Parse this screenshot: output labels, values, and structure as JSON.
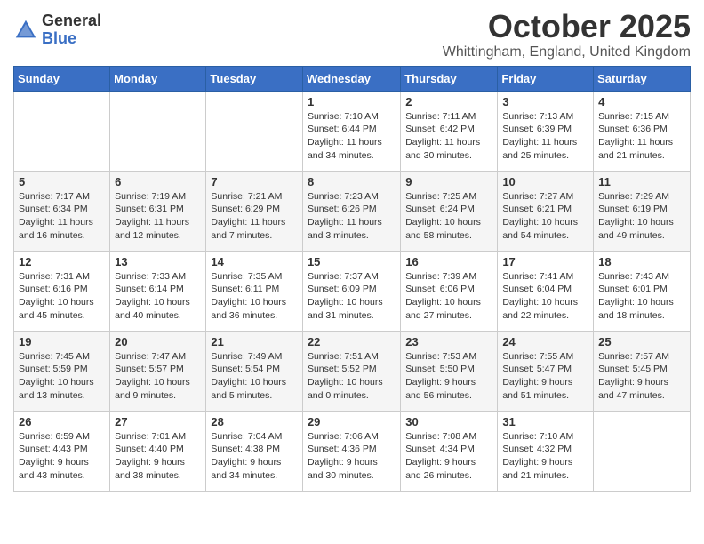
{
  "logo": {
    "general": "General",
    "blue": "Blue"
  },
  "title": "October 2025",
  "location": "Whittingham, England, United Kingdom",
  "days_of_week": [
    "Sunday",
    "Monday",
    "Tuesday",
    "Wednesday",
    "Thursday",
    "Friday",
    "Saturday"
  ],
  "weeks": [
    [
      {
        "day": "",
        "info": ""
      },
      {
        "day": "",
        "info": ""
      },
      {
        "day": "",
        "info": ""
      },
      {
        "day": "1",
        "info": "Sunrise: 7:10 AM\nSunset: 6:44 PM\nDaylight: 11 hours\nand 34 minutes."
      },
      {
        "day": "2",
        "info": "Sunrise: 7:11 AM\nSunset: 6:42 PM\nDaylight: 11 hours\nand 30 minutes."
      },
      {
        "day": "3",
        "info": "Sunrise: 7:13 AM\nSunset: 6:39 PM\nDaylight: 11 hours\nand 25 minutes."
      },
      {
        "day": "4",
        "info": "Sunrise: 7:15 AM\nSunset: 6:36 PM\nDaylight: 11 hours\nand 21 minutes."
      }
    ],
    [
      {
        "day": "5",
        "info": "Sunrise: 7:17 AM\nSunset: 6:34 PM\nDaylight: 11 hours\nand 16 minutes."
      },
      {
        "day": "6",
        "info": "Sunrise: 7:19 AM\nSunset: 6:31 PM\nDaylight: 11 hours\nand 12 minutes."
      },
      {
        "day": "7",
        "info": "Sunrise: 7:21 AM\nSunset: 6:29 PM\nDaylight: 11 hours\nand 7 minutes."
      },
      {
        "day": "8",
        "info": "Sunrise: 7:23 AM\nSunset: 6:26 PM\nDaylight: 11 hours\nand 3 minutes."
      },
      {
        "day": "9",
        "info": "Sunrise: 7:25 AM\nSunset: 6:24 PM\nDaylight: 10 hours\nand 58 minutes."
      },
      {
        "day": "10",
        "info": "Sunrise: 7:27 AM\nSunset: 6:21 PM\nDaylight: 10 hours\nand 54 minutes."
      },
      {
        "day": "11",
        "info": "Sunrise: 7:29 AM\nSunset: 6:19 PM\nDaylight: 10 hours\nand 49 minutes."
      }
    ],
    [
      {
        "day": "12",
        "info": "Sunrise: 7:31 AM\nSunset: 6:16 PM\nDaylight: 10 hours\nand 45 minutes."
      },
      {
        "day": "13",
        "info": "Sunrise: 7:33 AM\nSunset: 6:14 PM\nDaylight: 10 hours\nand 40 minutes."
      },
      {
        "day": "14",
        "info": "Sunrise: 7:35 AM\nSunset: 6:11 PM\nDaylight: 10 hours\nand 36 minutes."
      },
      {
        "day": "15",
        "info": "Sunrise: 7:37 AM\nSunset: 6:09 PM\nDaylight: 10 hours\nand 31 minutes."
      },
      {
        "day": "16",
        "info": "Sunrise: 7:39 AM\nSunset: 6:06 PM\nDaylight: 10 hours\nand 27 minutes."
      },
      {
        "day": "17",
        "info": "Sunrise: 7:41 AM\nSunset: 6:04 PM\nDaylight: 10 hours\nand 22 minutes."
      },
      {
        "day": "18",
        "info": "Sunrise: 7:43 AM\nSunset: 6:01 PM\nDaylight: 10 hours\nand 18 minutes."
      }
    ],
    [
      {
        "day": "19",
        "info": "Sunrise: 7:45 AM\nSunset: 5:59 PM\nDaylight: 10 hours\nand 13 minutes."
      },
      {
        "day": "20",
        "info": "Sunrise: 7:47 AM\nSunset: 5:57 PM\nDaylight: 10 hours\nand 9 minutes."
      },
      {
        "day": "21",
        "info": "Sunrise: 7:49 AM\nSunset: 5:54 PM\nDaylight: 10 hours\nand 5 minutes."
      },
      {
        "day": "22",
        "info": "Sunrise: 7:51 AM\nSunset: 5:52 PM\nDaylight: 10 hours\nand 0 minutes."
      },
      {
        "day": "23",
        "info": "Sunrise: 7:53 AM\nSunset: 5:50 PM\nDaylight: 9 hours\nand 56 minutes."
      },
      {
        "day": "24",
        "info": "Sunrise: 7:55 AM\nSunset: 5:47 PM\nDaylight: 9 hours\nand 51 minutes."
      },
      {
        "day": "25",
        "info": "Sunrise: 7:57 AM\nSunset: 5:45 PM\nDaylight: 9 hours\nand 47 minutes."
      }
    ],
    [
      {
        "day": "26",
        "info": "Sunrise: 6:59 AM\nSunset: 4:43 PM\nDaylight: 9 hours\nand 43 minutes."
      },
      {
        "day": "27",
        "info": "Sunrise: 7:01 AM\nSunset: 4:40 PM\nDaylight: 9 hours\nand 38 minutes."
      },
      {
        "day": "28",
        "info": "Sunrise: 7:04 AM\nSunset: 4:38 PM\nDaylight: 9 hours\nand 34 minutes."
      },
      {
        "day": "29",
        "info": "Sunrise: 7:06 AM\nSunset: 4:36 PM\nDaylight: 9 hours\nand 30 minutes."
      },
      {
        "day": "30",
        "info": "Sunrise: 7:08 AM\nSunset: 4:34 PM\nDaylight: 9 hours\nand 26 minutes."
      },
      {
        "day": "31",
        "info": "Sunrise: 7:10 AM\nSunset: 4:32 PM\nDaylight: 9 hours\nand 21 minutes."
      },
      {
        "day": "",
        "info": ""
      }
    ]
  ]
}
